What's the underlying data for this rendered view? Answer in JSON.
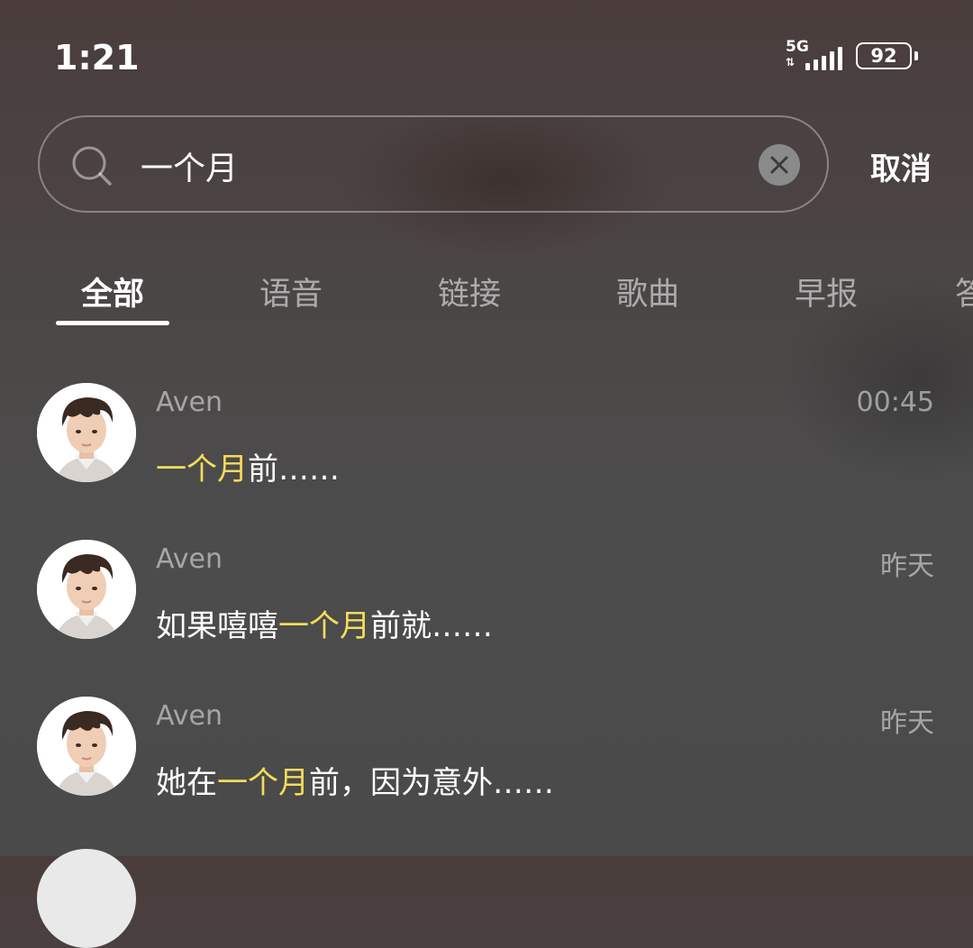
{
  "status_bar": {
    "time": "1:21",
    "network": "5G",
    "battery": "92"
  },
  "search": {
    "query": "一个月",
    "cancel_label": "取消"
  },
  "tabs": [
    {
      "label": "全部",
      "active": true
    },
    {
      "label": "语音",
      "active": false
    },
    {
      "label": "链接",
      "active": false
    },
    {
      "label": "歌曲",
      "active": false
    },
    {
      "label": "早报",
      "active": false
    },
    {
      "label": "答",
      "active": false
    }
  ],
  "results": [
    {
      "sender": "Aven",
      "time": "00:45",
      "message": {
        "before": "",
        "highlight": "一个月",
        "after": "前……"
      }
    },
    {
      "sender": "Aven",
      "time": "昨天",
      "message": {
        "before": "如果嘻嘻",
        "highlight": "一个月",
        "after": "前就……"
      }
    },
    {
      "sender": "Aven",
      "time": "昨天",
      "message": {
        "before": "她在",
        "highlight": "一个月",
        "after": "前，因为意外……"
      }
    }
  ],
  "colors": {
    "highlight": "#f5dc5a",
    "secondary_text": "#a8a8a8"
  }
}
